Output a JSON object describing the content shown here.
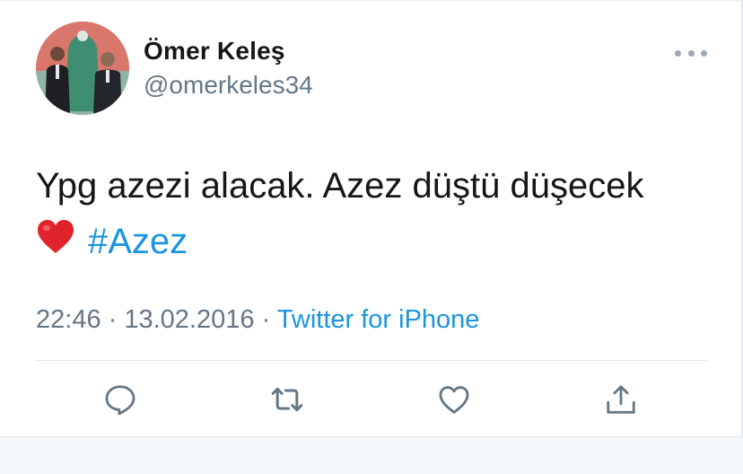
{
  "tweet": {
    "author_name": "Ömer Keleş",
    "author_handle": "@omerkeles34",
    "text": "Ypg azezi alacak. Azez düştü düşecek",
    "emoji": "heart-emoji",
    "hashtag": "#Azez",
    "time": "22:46",
    "separator": " · ",
    "date": "13.02.2016",
    "source": "Twitter for iPhone"
  },
  "actions": {
    "icons": [
      "reply-icon",
      "retweet-icon",
      "like-icon",
      "share-icon"
    ]
  },
  "colors": {
    "text": "#14171a",
    "secondary": "#657786",
    "link": "#1b95e0",
    "divider": "#e1e8ed",
    "heart": "#e0242b"
  }
}
